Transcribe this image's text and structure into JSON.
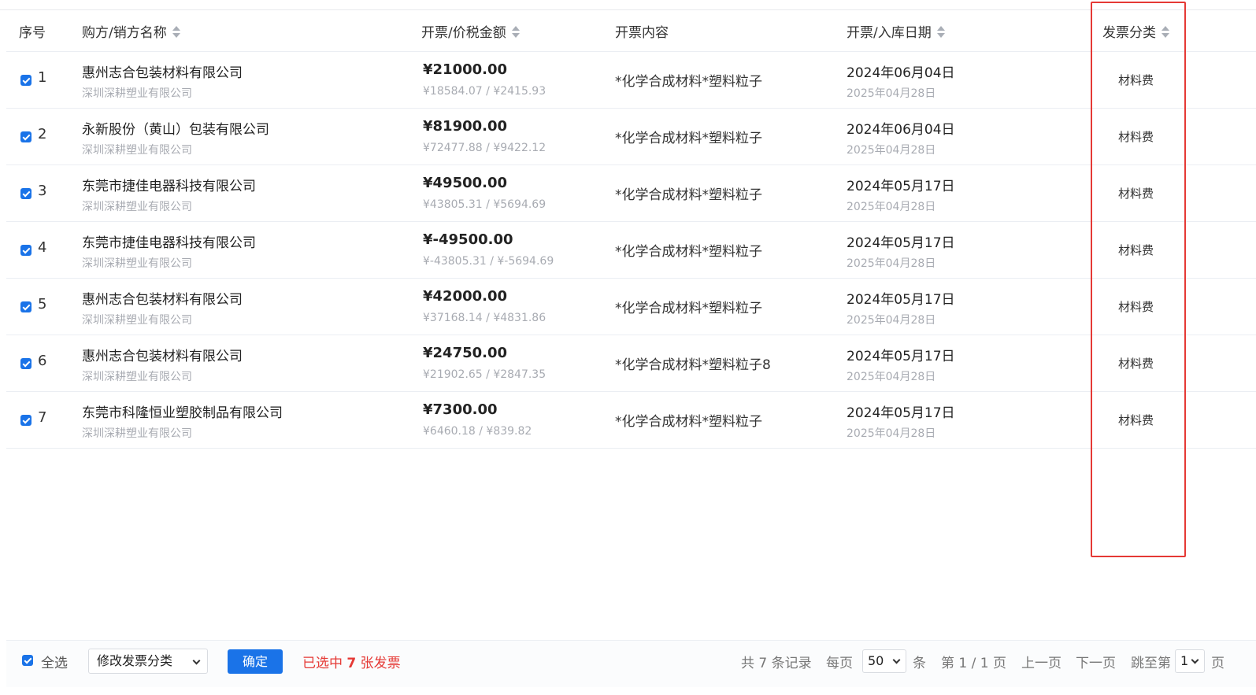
{
  "table": {
    "columns": {
      "index": "序号",
      "party": "购方/销方名称",
      "amount": "开票/价税金额",
      "content": "开票内容",
      "date": "开票/入库日期",
      "category": "发票分类"
    },
    "rows": [
      {
        "index": "1",
        "buyer": "惠州志合包装材料有限公司",
        "seller": "深圳深耕塑业有限公司",
        "amount": "¥21000.00",
        "amount_detail": "¥18584.07 / ¥2415.93",
        "content": "*化学合成材料*塑料粒子",
        "invoice_date": "2024年06月04日",
        "entry_date": "2025年04月28日",
        "category": "材料费",
        "checked": true
      },
      {
        "index": "2",
        "buyer": "永新股份（黄山）包装有限公司",
        "seller": "深圳深耕塑业有限公司",
        "amount": "¥81900.00",
        "amount_detail": "¥72477.88 / ¥9422.12",
        "content": "*化学合成材料*塑料粒子",
        "invoice_date": "2024年06月04日",
        "entry_date": "2025年04月28日",
        "category": "材料费",
        "checked": true
      },
      {
        "index": "3",
        "buyer": "东莞市捷佳电器科技有限公司",
        "seller": "深圳深耕塑业有限公司",
        "amount": "¥49500.00",
        "amount_detail": "¥43805.31 / ¥5694.69",
        "content": "*化学合成材料*塑料粒子",
        "invoice_date": "2024年05月17日",
        "entry_date": "2025年04月28日",
        "category": "材料费",
        "checked": true
      },
      {
        "index": "4",
        "buyer": "东莞市捷佳电器科技有限公司",
        "seller": "深圳深耕塑业有限公司",
        "amount": "¥-49500.00",
        "amount_detail": "¥-43805.31 / ¥-5694.69",
        "content": "*化学合成材料*塑料粒子",
        "invoice_date": "2024年05月17日",
        "entry_date": "2025年04月28日",
        "category": "材料费",
        "checked": true
      },
      {
        "index": "5",
        "buyer": "惠州志合包装材料有限公司",
        "seller": "深圳深耕塑业有限公司",
        "amount": "¥42000.00",
        "amount_detail": "¥37168.14 / ¥4831.86",
        "content": "*化学合成材料*塑料粒子",
        "invoice_date": "2024年05月17日",
        "entry_date": "2025年04月28日",
        "category": "材料费",
        "checked": true
      },
      {
        "index": "6",
        "buyer": "惠州志合包装材料有限公司",
        "seller": "深圳深耕塑业有限公司",
        "amount": "¥24750.00",
        "amount_detail": "¥21902.65 / ¥2847.35",
        "content": "*化学合成材料*塑料粒子8",
        "invoice_date": "2024年05月17日",
        "entry_date": "2025年04月28日",
        "category": "材料费",
        "checked": true
      },
      {
        "index": "7",
        "buyer": "东莞市科隆恒业塑胶制品有限公司",
        "seller": "深圳深耕塑业有限公司",
        "amount": "¥7300.00",
        "amount_detail": "¥6460.18 / ¥839.82",
        "content": "*化学合成材料*塑料粒子",
        "invoice_date": "2024年05月17日",
        "entry_date": "2025年04月28日",
        "category": "材料费",
        "checked": true
      }
    ]
  },
  "footer": {
    "select_all_label": "全选",
    "select_all_checked": true,
    "action_select_value": "修改发票分类",
    "confirm_label": "确定",
    "selected_prefix": "已选中",
    "selected_count": "7",
    "selected_suffix": "张发票"
  },
  "pagination": {
    "total_text": "共 7 条记录",
    "per_page_label": "每页",
    "per_page_value": "50",
    "per_page_unit": "条",
    "page_info": "第 1 / 1 页",
    "prev_label": "上一页",
    "next_label": "下一页",
    "jump_label": "跳至第",
    "jump_value": "1",
    "jump_unit": "页"
  },
  "colors": {
    "accent": "#1a73e8",
    "highlight_box": "#e53935",
    "selected_text": "#e53935"
  }
}
